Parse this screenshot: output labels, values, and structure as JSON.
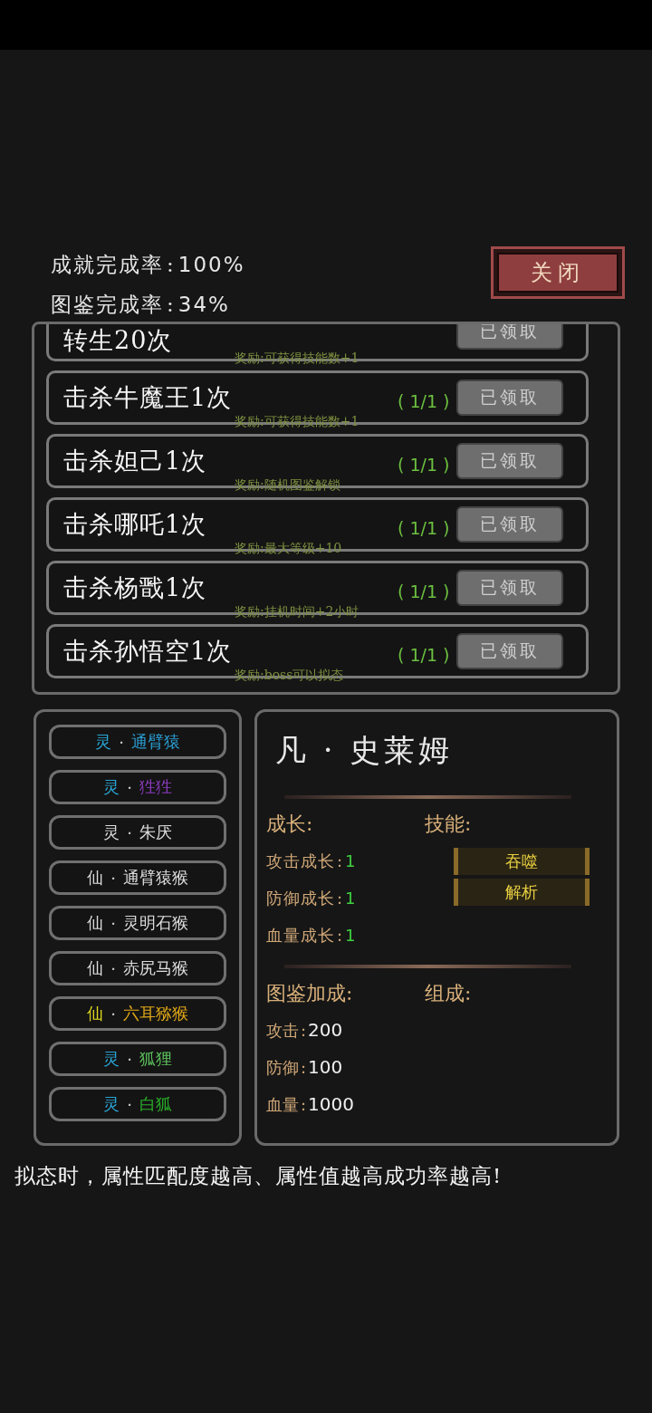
{
  "stats": [
    {
      "label": "成就完成率",
      "sep": ":",
      "value": "100%"
    },
    {
      "label": "图鉴完成率",
      "sep": ":",
      "value": "34%"
    }
  ],
  "close_button": "关闭",
  "achievements": [
    {
      "title": "转生20次",
      "reward": "奖励:可获得技能数+1",
      "claim": "已领取",
      "claimed": true
    },
    {
      "title": "击杀牛魔王1次",
      "progress": "( 1/1 )",
      "reward": "奖励:可获得技能数+1",
      "claim": "已领取",
      "claimed": true
    },
    {
      "title": "击杀妲己1次",
      "progress": "( 1/1 )",
      "reward": "奖励:随机图鉴解锁",
      "claim": "已领取",
      "claimed": true
    },
    {
      "title": "击杀哪吒1次",
      "progress": "( 1/1 )",
      "reward": "奖励:最大等级+10",
      "claim": "已领取",
      "claimed": true
    },
    {
      "title": "击杀杨戬1次",
      "progress": "( 1/1 )",
      "reward": "奖励:挂机时间+2小时",
      "claim": "已领取",
      "claimed": true
    },
    {
      "title": "击杀孙悟空1次",
      "progress": "( 1/1 )",
      "reward": "奖励:boss可以拟态",
      "claim": "已领取",
      "claimed": true
    }
  ],
  "creatures": [
    {
      "prefix": {
        "text": "灵",
        "color": "#2aa6d6"
      },
      "sep": "·",
      "name": {
        "text": "通臂猿",
        "color": "#2a9cd0"
      }
    },
    {
      "prefix": {
        "text": "灵",
        "color": "#2aa6d6"
      },
      "sep": "·",
      "name": {
        "text": "狌狌",
        "color": "#8e3cc0"
      }
    },
    {
      "prefix": {
        "text": "灵",
        "color": "#dddddd"
      },
      "sep": "·",
      "name": {
        "text": "朱厌",
        "color": "#dddddd"
      }
    },
    {
      "prefix": {
        "text": "仙",
        "color": "#dddddd"
      },
      "sep": "·",
      "name": {
        "text": "通臂猿猴",
        "color": "#dddddd"
      }
    },
    {
      "prefix": {
        "text": "仙",
        "color": "#dddddd"
      },
      "sep": "·",
      "name": {
        "text": "灵明石猴",
        "color": "#dddddd"
      }
    },
    {
      "prefix": {
        "text": "仙",
        "color": "#dddddd"
      },
      "sep": "·",
      "name": {
        "text": "赤尻马猴",
        "color": "#dddddd"
      }
    },
    {
      "prefix": {
        "text": "仙",
        "color": "#e0d820"
      },
      "sep": "·",
      "name": {
        "text": "六耳猕猴",
        "color": "#e0a818"
      }
    },
    {
      "prefix": {
        "text": "灵",
        "color": "#2aa6d6"
      },
      "sep": "·",
      "name": {
        "text": "狐狸",
        "color": "#5cc05c"
      }
    },
    {
      "prefix": {
        "text": "灵",
        "color": "#2aa6d6"
      },
      "sep": "·",
      "name": {
        "text": "白狐",
        "color": "#28b028"
      }
    }
  ],
  "detail": {
    "title": "凡 · 史莱姆",
    "growth_heading": "成长:",
    "growth": [
      {
        "label": "攻击成长",
        "sep": ":",
        "value": "1"
      },
      {
        "label": "防御成长",
        "sep": ":",
        "value": "1"
      },
      {
        "label": "血量成长",
        "sep": ":",
        "value": "1"
      }
    ],
    "skills_heading": "技能:",
    "skills": [
      "吞噬",
      "解析"
    ],
    "bonus_heading": "图鉴加成:",
    "composition_heading": "组成:",
    "bonus": [
      {
        "label": "攻击",
        "sep": ":",
        "value": "200"
      },
      {
        "label": "防御",
        "sep": ":",
        "value": "100"
      },
      {
        "label": "血量",
        "sep": ":",
        "value": "1000"
      }
    ]
  },
  "hint": "拟态时，属性匹配度越高、属性值越高成功率越高!"
}
